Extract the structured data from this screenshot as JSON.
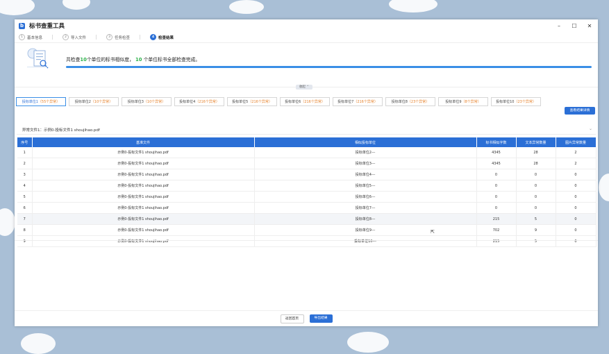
{
  "window": {
    "title": "标书查重工具",
    "logo_letter": "b",
    "controls": [
      "–",
      "☐",
      "✕"
    ]
  },
  "steps": [
    {
      "num": "1",
      "label": "基本信息"
    },
    {
      "num": "2",
      "label": "导入文件"
    },
    {
      "num": "3",
      "label": "任务检查"
    },
    {
      "num": "4",
      "label": "检查结果"
    }
  ],
  "summary": {
    "prefix": "共检查",
    "count1": "10",
    "middle": "个单位的标书相似度，",
    "count2": "10",
    "suffix": " 个单位标书全部检查完成。",
    "progress_percent": 100,
    "collapse_label": "收起 ⌃"
  },
  "tabs": [
    {
      "name": "投标单位1",
      "count": "（55个异常）"
    },
    {
      "name": "投标单位2",
      "count": "（10个异常）"
    },
    {
      "name": "投标单位3",
      "count": "（10个异常）"
    },
    {
      "name": "投标单位4",
      "count": "（216个异常）"
    },
    {
      "name": "投标单位5",
      "count": "（216个异常）"
    },
    {
      "name": "投标单位6",
      "count": "（216个异常）"
    },
    {
      "name": "投标单位7",
      "count": "（216个异常）"
    },
    {
      "name": "投标单位8",
      "count": "（23个异常）"
    },
    {
      "name": "投标单位9",
      "count": "（8个异常）"
    },
    {
      "name": "投标单位10",
      "count": "（23个异常）"
    }
  ],
  "view_details_button": "查看结果详情",
  "file_label": "异常文件1：示例0-投标文件1 shoujihao.pdf",
  "table": {
    "headers": [
      "序号",
      "基准文件",
      "相似投标单位",
      "标书相似字数",
      "文本异常数量",
      "图片异常数量"
    ],
    "rows": [
      [
        "1",
        "示例0-投标文件1 shoujihao.pdf",
        "投标单位2---",
        "4345",
        "28",
        "2"
      ],
      [
        "2",
        "示例0-投标文件1 shoujihao.pdf",
        "投标单位3---",
        "4345",
        "28",
        "2"
      ],
      [
        "3",
        "示例0-投标文件1 shoujihao.pdf",
        "投标单位4---",
        "0",
        "0",
        "0"
      ],
      [
        "4",
        "示例0-投标文件1 shoujihao.pdf",
        "投标单位5---",
        "0",
        "0",
        "0"
      ],
      [
        "5",
        "示例0-投标文件1 shoujihao.pdf",
        "投标单位6---",
        "0",
        "0",
        "0"
      ],
      [
        "6",
        "示例0-投标文件1 shoujihao.pdf",
        "投标单位7---",
        "0",
        "0",
        "0"
      ],
      [
        "7",
        "示例0-投标文件1 shoujihao.pdf",
        "投标单位8---",
        "215",
        "5",
        "0"
      ],
      [
        "8",
        "示例0-投标文件1 shoujihao.pdf",
        "投标单位9---",
        "702",
        "9",
        "0"
      ],
      [
        "9",
        "示例0-投标文件1 shoujihao.pdf",
        "投标单位10---",
        "215",
        "5",
        "0"
      ]
    ]
  },
  "footer": {
    "back_label": "返回首页",
    "export_label": "导出结果"
  },
  "colors": {
    "primary": "#2b6fd6",
    "highlight_green": "#2db24a",
    "count_orange": "#e6822c",
    "value_red": "#e04a3c"
  }
}
